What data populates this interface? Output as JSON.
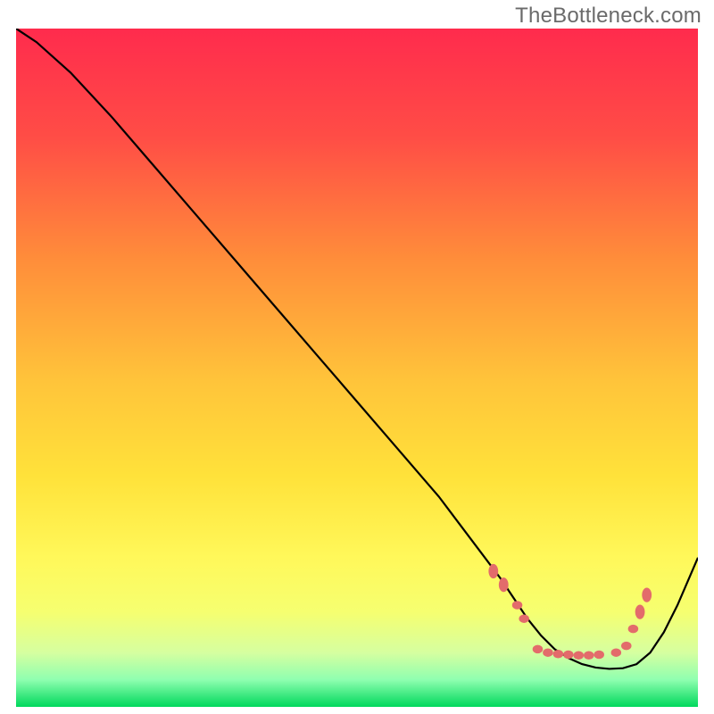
{
  "watermark": "TheBottleneck.com",
  "chart_data": {
    "type": "line",
    "title": "",
    "xlabel": "",
    "ylabel": "",
    "xlim": [
      0,
      100
    ],
    "ylim": [
      0,
      100
    ],
    "gradient_colors": {
      "top": "#ff2b4d",
      "mid_upper": "#ff8d3a",
      "mid": "#ffe23a",
      "mid_lower": "#f6ff70",
      "bottom": "#00d85c"
    },
    "series": [
      {
        "name": "bottleneck-curve",
        "color": "#000000",
        "stroke_width": 2.2,
        "x": [
          0,
          3,
          8,
          14,
          20,
          26,
          32,
          38,
          44,
          50,
          56,
          62,
          65,
          68,
          71,
          73,
          75,
          77,
          79,
          81,
          83,
          85,
          87,
          89,
          91,
          93,
          95,
          97,
          100
        ],
        "y": [
          100,
          98,
          93.5,
          87,
          80,
          73,
          66,
          59,
          52,
          45,
          38,
          31,
          27,
          23,
          19,
          16,
          13,
          10.5,
          8.5,
          7.2,
          6.3,
          5.8,
          5.6,
          5.7,
          6.3,
          8.0,
          11,
          15,
          22
        ]
      },
      {
        "name": "optimal-markers",
        "type": "scatter",
        "color": "#e36b6b",
        "marker_radius_main": 6,
        "marker_radius_sub": 5,
        "points": [
          {
            "x": 70.0,
            "y": 20.0
          },
          {
            "x": 71.5,
            "y": 18.0
          },
          {
            "x": 73.5,
            "y": 15.0
          },
          {
            "x": 74.5,
            "y": 13.0
          },
          {
            "x": 76.5,
            "y": 8.5
          },
          {
            "x": 78.0,
            "y": 8.0
          },
          {
            "x": 79.5,
            "y": 7.8
          },
          {
            "x": 81.0,
            "y": 7.7
          },
          {
            "x": 82.5,
            "y": 7.6
          },
          {
            "x": 84.0,
            "y": 7.6
          },
          {
            "x": 85.5,
            "y": 7.7
          },
          {
            "x": 88.0,
            "y": 8.0
          },
          {
            "x": 89.5,
            "y": 9.0
          },
          {
            "x": 90.5,
            "y": 11.5
          },
          {
            "x": 91.5,
            "y": 14.0
          },
          {
            "x": 92.5,
            "y": 16.5
          }
        ]
      }
    ]
  }
}
